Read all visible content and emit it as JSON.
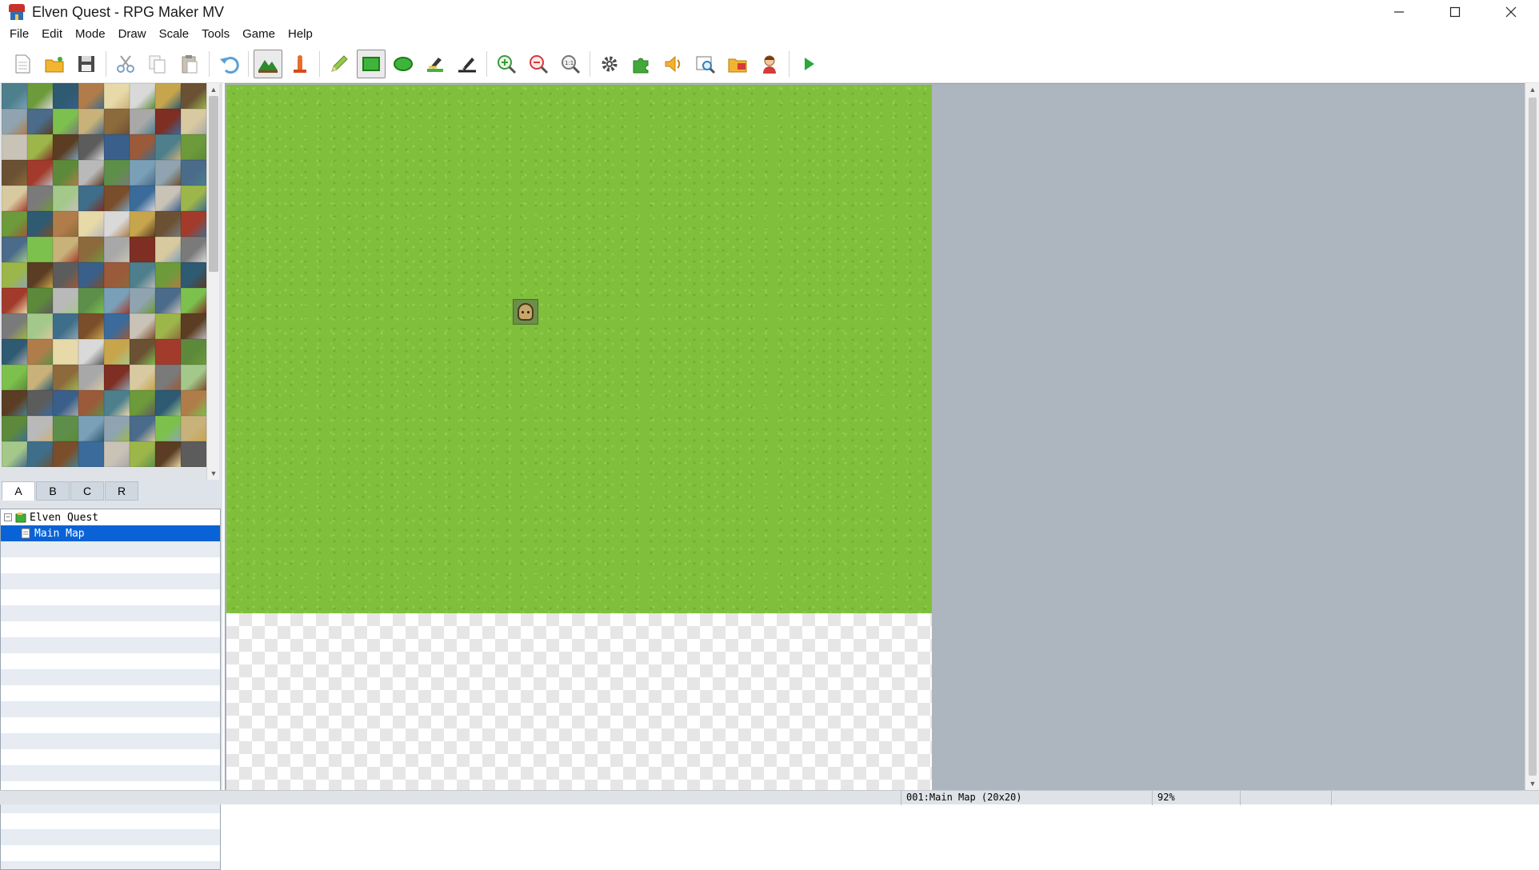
{
  "window": {
    "title": "Elven Quest - RPG Maker MV"
  },
  "menu": [
    "File",
    "Edit",
    "Mode",
    "Draw",
    "Scale",
    "Tools",
    "Game",
    "Help"
  ],
  "toolbar": {
    "buttons": [
      {
        "name": "new-project-icon"
      },
      {
        "name": "open-project-icon"
      },
      {
        "name": "save-project-icon"
      },
      {
        "name": "cut-icon"
      },
      {
        "name": "copy-icon"
      },
      {
        "name": "paste-icon"
      },
      {
        "name": "undo-icon"
      },
      {
        "name": "map-mode-icon",
        "active": true
      },
      {
        "name": "event-mode-icon"
      },
      {
        "name": "pencil-icon"
      },
      {
        "name": "rectangle-icon",
        "active": true
      },
      {
        "name": "ellipse-icon"
      },
      {
        "name": "flood-fill-icon"
      },
      {
        "name": "shadow-pen-icon"
      },
      {
        "name": "zoom-in-icon"
      },
      {
        "name": "zoom-out-icon"
      },
      {
        "name": "actual-size-icon"
      },
      {
        "name": "database-icon"
      },
      {
        "name": "plugin-manager-icon"
      },
      {
        "name": "sound-test-icon"
      },
      {
        "name": "event-searcher-icon"
      },
      {
        "name": "resource-manager-icon"
      },
      {
        "name": "character-generator-icon"
      },
      {
        "name": "playtest-icon"
      }
    ]
  },
  "tileset": {
    "tabs": [
      "A",
      "B",
      "C",
      "R"
    ],
    "active_tab": "A"
  },
  "map_tree": {
    "project": "Elven Quest",
    "maps": [
      {
        "label": "Main Map",
        "selected": true
      }
    ]
  },
  "status": {
    "map_info": "001:Main Map (20x20)",
    "zoom": "92%"
  },
  "colors": {
    "selection": "#0a63d6",
    "grass": "#7fbf3c",
    "canvas_bg": "#adb5bf"
  }
}
